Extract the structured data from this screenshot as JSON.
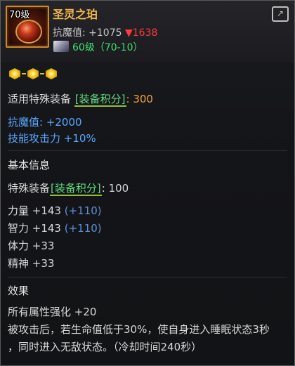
{
  "item": {
    "level_tag": "70级",
    "name": "圣灵之珀",
    "magic_resist_label": "抗魔值: ",
    "magic_resist_value": "+1075",
    "magic_resist_diff": "▼1638",
    "required_level": "60级（70-10）"
  },
  "sockets": {
    "count": 3
  },
  "applicable": {
    "label": "适用特殊装备",
    "tag": "[装备积分]",
    "sep": ": ",
    "value": "300"
  },
  "bonus": {
    "line1": "抗魔值: +2000",
    "line2": "技能攻击力 +10%"
  },
  "basic_info": {
    "title": "基本信息",
    "special_label": "特殊装备",
    "special_tag": "[装备积分]",
    "special_sep": ": ",
    "special_value": "100",
    "stats": [
      {
        "label": "力量 +143",
        "extra": "(+110)"
      },
      {
        "label": "智力 +143",
        "extra": "(+110)"
      },
      {
        "label": "体力 +33",
        "extra": ""
      },
      {
        "label": "精神 +33",
        "extra": ""
      }
    ]
  },
  "effect": {
    "title": "效果",
    "line1": "所有属性强化 +20",
    "line2": "被攻击后，若生命值低于30%，使自身进入睡眠状态3秒",
    "line3": "，同时进入无敌状态。（冷却时间240秒）"
  },
  "colors": {
    "name": "#f0b64a",
    "diff_down": "#ff3a3a",
    "req_green": "#3fe06a",
    "bonus_blue": "#5aa8ff",
    "value_orange": "#f2a23a"
  }
}
